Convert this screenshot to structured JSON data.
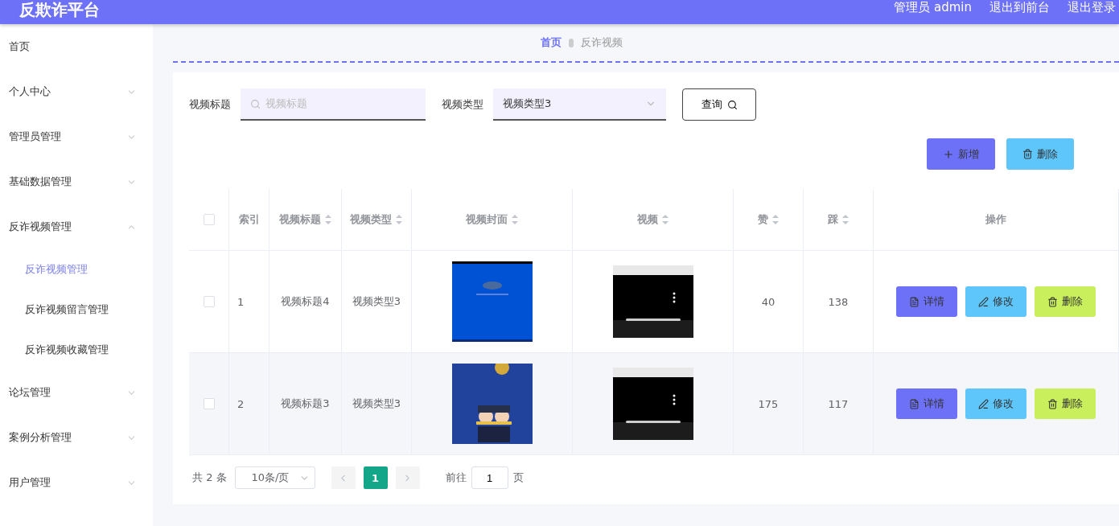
{
  "header": {
    "title": "反欺诈平台",
    "links": [
      "管理员 admin",
      "退出到前台",
      "退出登录"
    ]
  },
  "sidebar": {
    "items": [
      {
        "label": "首页",
        "has_arrow": false
      },
      {
        "label": "个人中心",
        "expanded": false,
        "has_arrow": true
      },
      {
        "label": "管理员管理",
        "expanded": false,
        "has_arrow": true
      },
      {
        "label": "基础数据管理",
        "expanded": false,
        "has_arrow": true
      },
      {
        "label": "反诈视频管理",
        "expanded": true,
        "has_arrow": true,
        "children": [
          {
            "label": "反诈视频管理",
            "selected": true
          },
          {
            "label": "反诈视频留言管理",
            "selected": false
          },
          {
            "label": "反诈视频收藏管理",
            "selected": false
          }
        ]
      },
      {
        "label": "论坛管理",
        "expanded": false,
        "has_arrow": true
      },
      {
        "label": "案例分析管理",
        "expanded": false,
        "has_arrow": true
      },
      {
        "label": "用户管理",
        "expanded": false,
        "has_arrow": true
      }
    ]
  },
  "breadcrumb": [
    "首页",
    "反诈视频"
  ],
  "filters": [
    {
      "label": "视频标题",
      "kind": "input",
      "placeholder": "视频标题"
    },
    {
      "label": "视频类型",
      "kind": "select",
      "value": "视频类型3"
    }
  ],
  "search_button": "查询",
  "actions": [
    {
      "label": "新增",
      "kind": "add"
    },
    {
      "label": "删除",
      "kind": "delete"
    }
  ],
  "table": {
    "columns": [
      {
        "kind": "check",
        "checked": false
      },
      {
        "label": "索引",
        "sortable": false
      },
      {
        "label": "视频标题",
        "sortable": true
      },
      {
        "label": "视频类型",
        "sortable": true
      },
      {
        "label": "视频封面",
        "sortable": true
      },
      {
        "label": "视频",
        "sortable": true
      },
      {
        "label": "赞",
        "sortable": true
      },
      {
        "label": "踩",
        "sortable": true
      },
      {
        "label": "操作",
        "sortable": false
      }
    ],
    "rows": [
      {
        "checked": false,
        "index": "1",
        "title": "视频标题4",
        "type": "视频类型3",
        "likes": "40",
        "dislikes": "138",
        "buttons": [
          {
            "label": "详情",
            "kind": "detail"
          },
          {
            "label": "修改",
            "kind": "edit"
          },
          {
            "label": "删除",
            "kind": "delete"
          }
        ]
      },
      {
        "checked": false,
        "index": "2",
        "title": "视频标题3",
        "type": "视频类型3",
        "likes": "175",
        "dislikes": "117",
        "buttons": [
          {
            "label": "详情",
            "kind": "detail"
          },
          {
            "label": "修改",
            "kind": "edit"
          },
          {
            "label": "删除",
            "kind": "delete"
          }
        ]
      }
    ]
  },
  "pagination": {
    "total": "共 2 条",
    "page_size": "10条/页",
    "pages": [
      {
        "label": "1",
        "selected": true
      }
    ],
    "goto_label": "前往",
    "goto_value": "1",
    "goto_suffix": "页"
  }
}
